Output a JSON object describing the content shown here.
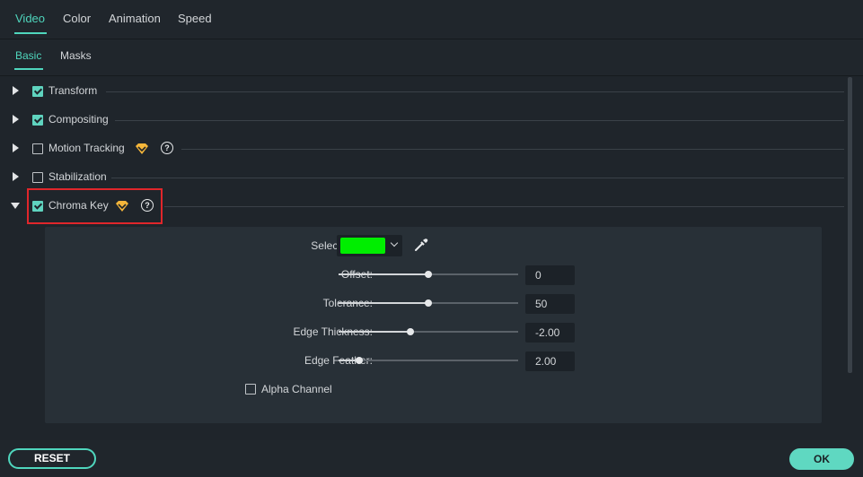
{
  "tabs": [
    {
      "label": "Video",
      "active": true
    },
    {
      "label": "Color",
      "active": false
    },
    {
      "label": "Animation",
      "active": false
    },
    {
      "label": "Speed",
      "active": false
    }
  ],
  "subtabs": [
    {
      "label": "Basic",
      "active": true
    },
    {
      "label": "Masks",
      "active": false
    }
  ],
  "sections": [
    {
      "label": "Transform",
      "checked": true,
      "expanded": false
    },
    {
      "label": "Compositing",
      "checked": true,
      "expanded": false
    },
    {
      "label": "Motion Tracking",
      "checked": false,
      "expanded": false,
      "premium": true,
      "help": true
    },
    {
      "label": "Stabilization",
      "checked": false,
      "expanded": false
    },
    {
      "label": "Chroma Key",
      "checked": true,
      "expanded": true,
      "premium": true,
      "help": true
    }
  ],
  "chroma_key": {
    "select_color_label": "Select Color:",
    "selected_color": "#00EE00",
    "offset": {
      "label": "Offset:",
      "value": "0",
      "level": 0.5
    },
    "tolerance": {
      "label": "Tolerance:",
      "value": "50",
      "level": 0.5
    },
    "edge_thickness": {
      "label": "Edge Thickness:",
      "value": "-2.00",
      "level": 0.4
    },
    "edge_feather": {
      "label": "Edge Feather:",
      "value": "2.00",
      "level": 0.115
    },
    "alpha_channel": {
      "label": "Alpha Channel",
      "checked": false
    }
  },
  "icons": {
    "help_glyph": "?"
  },
  "buttons": {
    "reset": "RESET",
    "ok": "OK"
  },
  "colors": {
    "accent": "#4FD6BD",
    "highlight_border": "#E0262B",
    "premium": "#F5B63A"
  }
}
